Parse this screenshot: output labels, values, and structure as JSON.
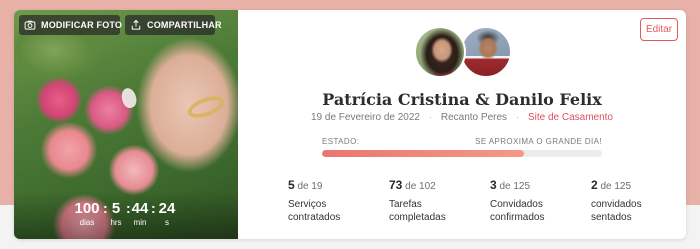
{
  "photo": {
    "modify_label": "MODIFICAR FOTO",
    "share_label": "COMPARTILHAR",
    "camera_icon": "camera-icon",
    "share_icon": "share-icon"
  },
  "countdown": {
    "days": {
      "value": "100",
      "label": "dias"
    },
    "hours": {
      "value": "5",
      "label": "hrs"
    },
    "minutes": {
      "value": "44",
      "label": "min"
    },
    "seconds": {
      "value": "24",
      "label": "s"
    },
    "separator": ":"
  },
  "header": {
    "edit_label": "Editar",
    "couple_name": "Patrícia Cristina & Danilo Felix",
    "date": "19 de Fevereiro de 2022",
    "venue": "Recanto Peres",
    "site_link": "Site de Casamento",
    "separator": "·"
  },
  "status": {
    "label": "ESTADO:",
    "message": "SE APROXIMA O GRANDE DIA!",
    "progress_fraction": 0.72
  },
  "stats": [
    {
      "done": "5",
      "of": "de 19",
      "label": "Serviços contratados"
    },
    {
      "done": "73",
      "of": "de 102",
      "label": "Tarefas completadas"
    },
    {
      "done": "3",
      "of": "de 125",
      "label": "Convidados confirmados"
    },
    {
      "done": "2",
      "of": "de 125",
      "label": "convidados sentados"
    }
  ],
  "colors": {
    "accent": "#e45a5a",
    "page_background": "#e8b1a8",
    "progress": "#ea7670"
  }
}
